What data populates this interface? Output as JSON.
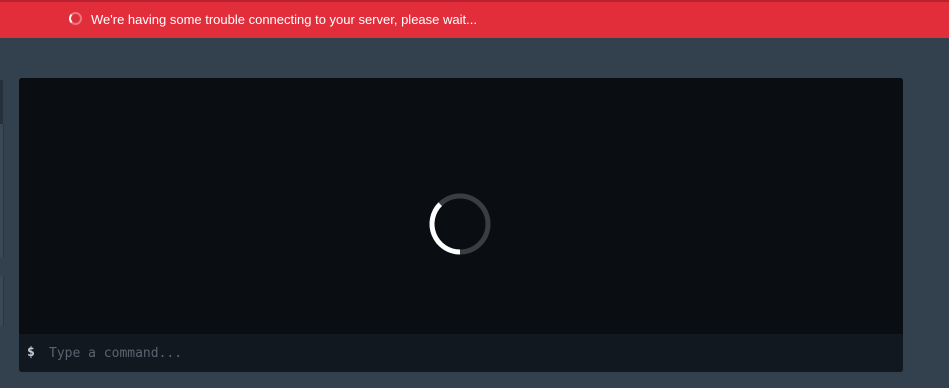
{
  "banner": {
    "message": "We're having some trouble connecting to your server, please wait...",
    "color": "#e22d3b",
    "icon": "spinner-icon"
  },
  "console": {
    "loading_icon": "loading-spinner-icon",
    "prompt_symbol": "$",
    "input_placeholder": "Type a command...",
    "input_value": ""
  },
  "colors": {
    "page_background": "#33404d",
    "console_background": "#0a0d12",
    "command_bar_background": "#121820"
  }
}
